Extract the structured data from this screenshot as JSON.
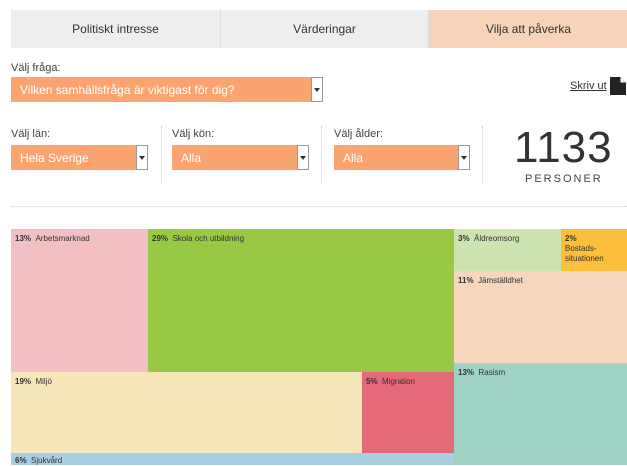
{
  "tabs": [
    {
      "label": "Politiskt intresse"
    },
    {
      "label": "Värderingar"
    },
    {
      "label": "Vilja att påverka"
    }
  ],
  "question": {
    "label": "Välj fråga:",
    "value": "Vilken samhällsfråga är viktigast för dig?"
  },
  "print_label": "Skriv ut",
  "filters": {
    "county": {
      "label": "Välj län:",
      "value": "Hela Sverige"
    },
    "gender": {
      "label": "Välj kön:",
      "value": "Alla"
    },
    "age": {
      "label": "Välj ålder:",
      "value": "Alla"
    }
  },
  "respondents": {
    "count": "1133",
    "unit": "PERSONER"
  },
  "colors": {
    "accent": "#fca470",
    "tab_active": "#f6d3b9",
    "tab_inactive": "#eeeeee"
  },
  "treemap": [
    {
      "pct": "13%",
      "label": "Arbetsmarknad",
      "color": "#f2c0c4"
    },
    {
      "pct": "29%",
      "label": "Skola och utbildning",
      "color": "#97c944"
    },
    {
      "pct": "3%",
      "label": "Äldreomsorg",
      "color": "#cfe3b0"
    },
    {
      "pct": "2%",
      "label": "Bostads-situationen",
      "color": "#fbbf3c"
    },
    {
      "pct": "11%",
      "label": "Jämställdhet",
      "color": "#f6d6bd"
    },
    {
      "pct": "19%",
      "label": "Miljö",
      "color": "#f6e6b9"
    },
    {
      "pct": "5%",
      "label": "Migration",
      "color": "#e46a78"
    },
    {
      "pct": "13%",
      "label": "Rasism",
      "color": "#9fd1c4"
    },
    {
      "pct": "6%",
      "label": "Sjukvård",
      "color": "#a9cfe4"
    }
  ]
}
